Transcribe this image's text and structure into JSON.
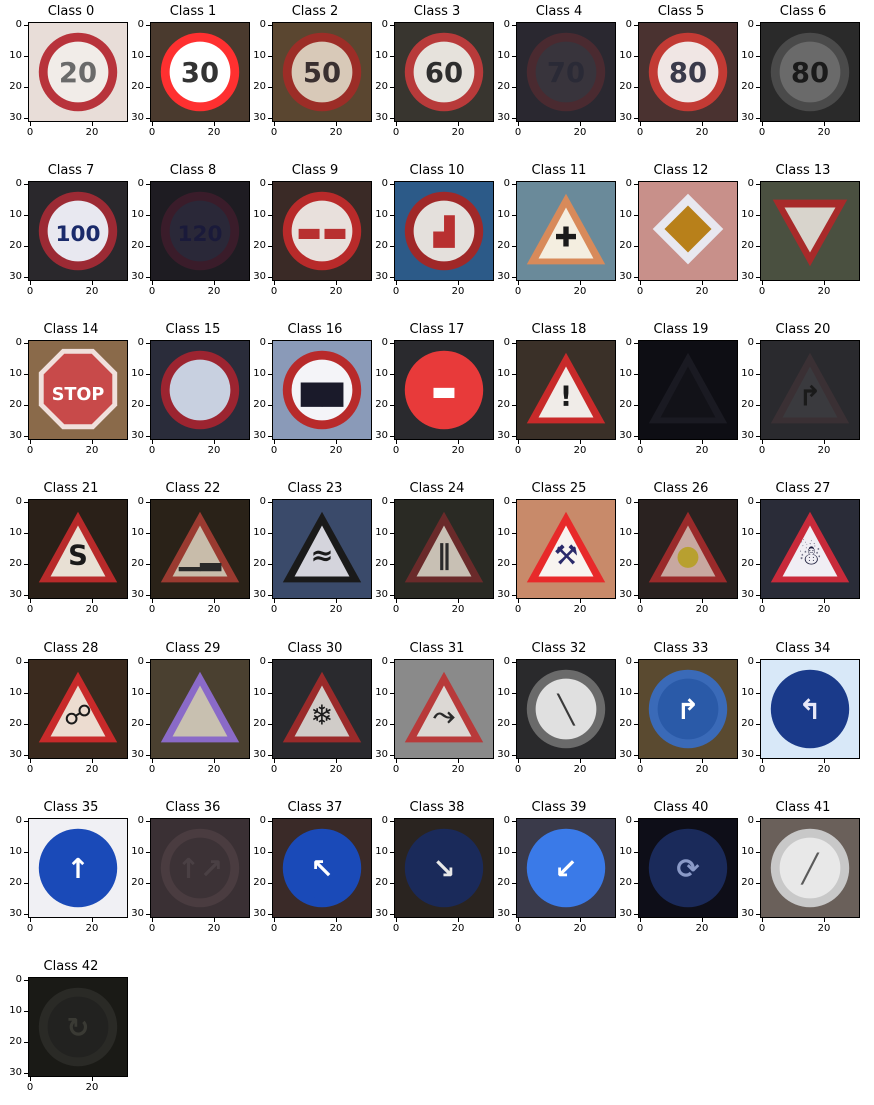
{
  "figure": {
    "axis_ticks": {
      "y": [
        "0",
        "10",
        "20",
        "30"
      ],
      "x": [
        "0",
        "20"
      ]
    },
    "panels": [
      {
        "title": "Class 0",
        "bg": "#e8ddd8",
        "shape": "circle",
        "ring": "#b8333b",
        "fill": "#f1ece8",
        "glyph": "20",
        "glyph_color": "#6a6a6a"
      },
      {
        "title": "Class 1",
        "bg": "#4a3a2e",
        "shape": "circle",
        "ring": "#ff3030",
        "fill": "#ffffff",
        "glyph": "30",
        "glyph_color": "#333333"
      },
      {
        "title": "Class 2",
        "bg": "#5a4630",
        "shape": "circle",
        "ring": "#9c2d27",
        "fill": "#d8c9b8",
        "glyph": "50",
        "glyph_color": "#3a3030"
      },
      {
        "title": "Class 3",
        "bg": "#38352f",
        "shape": "circle",
        "ring": "#b83a3a",
        "fill": "#e6e2dc",
        "glyph": "60",
        "glyph_color": "#2e2e2e"
      },
      {
        "title": "Class 4",
        "bg": "#2a2830",
        "shape": "circle",
        "ring": "#4a2a30",
        "fill": "#38343c",
        "glyph": "70",
        "glyph_color": "#2a2a36"
      },
      {
        "title": "Class 5",
        "bg": "#4a3230",
        "shape": "circle",
        "ring": "#c23a34",
        "fill": "#f0e6e4",
        "glyph": "80",
        "glyph_color": "#3a3a4a"
      },
      {
        "title": "Class 6",
        "bg": "#2a2a2a",
        "shape": "circle",
        "ring": "#4a4a4a",
        "fill": "#6a6a6a",
        "glyph": "80",
        "glyph_color": "#1a1a1a"
      },
      {
        "title": "Class 7",
        "bg": "#2a282c",
        "shape": "circle",
        "ring": "#9c2a34",
        "fill": "#e8e8f0",
        "glyph": "100",
        "glyph_color": "#1a2a6a"
      },
      {
        "title": "Class 8",
        "bg": "#1e1c22",
        "shape": "circle",
        "ring": "#3a1c2a",
        "fill": "#2a2838",
        "glyph": "120",
        "glyph_color": "#1a1a3a"
      },
      {
        "title": "Class 9",
        "bg": "#3a2a26",
        "shape": "circle",
        "ring": "#b82a2a",
        "fill": "#e8e0dc",
        "glyph": "▬▬",
        "glyph_color": "#b83030"
      },
      {
        "title": "Class 10",
        "bg": "#2c5a88",
        "shape": "circle",
        "ring": "#a02828",
        "fill": "#e4e0dc",
        "glyph": "▟",
        "glyph_color": "#b83030"
      },
      {
        "title": "Class 11",
        "bg": "#6a8a9a",
        "shape": "triangle",
        "ring": "#d88a5a",
        "fill": "#f4eee0",
        "glyph": "✚",
        "glyph_color": "#1a1a1a"
      },
      {
        "title": "Class 12",
        "bg": "#c8908a",
        "shape": "diamond",
        "ring": "#e8e8f0",
        "fill": "#b8801a",
        "glyph": "",
        "glyph_color": "#000000"
      },
      {
        "title": "Class 13",
        "bg": "#4a5040",
        "shape": "yield",
        "ring": "#a82a2a",
        "fill": "#d8d4cc",
        "glyph": "",
        "glyph_color": "#000000"
      },
      {
        "title": "Class 14",
        "bg": "#8a6a4a",
        "shape": "octagon",
        "ring": "#f0e0dc",
        "fill": "#c84a4a",
        "glyph": "STOP",
        "glyph_color": "#ffffff"
      },
      {
        "title": "Class 15",
        "bg": "#2a2c3a",
        "shape": "circle",
        "ring": "#9c2430",
        "fill": "#c8d0e0",
        "glyph": "",
        "glyph_color": "#000000"
      },
      {
        "title": "Class 16",
        "bg": "#8a9ab8",
        "shape": "circle",
        "ring": "#b82a2a",
        "fill": "#f4f4f8",
        "glyph": "▆▆",
        "glyph_color": "#1a1a2a"
      },
      {
        "title": "Class 17",
        "bg": "#2a2a2e",
        "shape": "circle",
        "ring": "#e83a3a",
        "fill": "#e83a3a",
        "glyph": "▬",
        "glyph_color": "#ffffff"
      },
      {
        "title": "Class 18",
        "bg": "#3a3028",
        "shape": "triangle",
        "ring": "#c82a2a",
        "fill": "#f0ece8",
        "glyph": "!",
        "glyph_color": "#1a1a1a"
      },
      {
        "title": "Class 19",
        "bg": "#0e0e14",
        "shape": "triangle",
        "ring": "#1a1a22",
        "fill": "#121218",
        "glyph": "",
        "glyph_color": "#000000"
      },
      {
        "title": "Class 20",
        "bg": "#2a2a2e",
        "shape": "triangle",
        "ring": "#3a3034",
        "fill": "#3a3a3e",
        "glyph": "↱",
        "glyph_color": "#1a1a1a"
      },
      {
        "title": "Class 21",
        "bg": "#2a2018",
        "shape": "triangle",
        "ring": "#b82a2a",
        "fill": "#e8e0d4",
        "glyph": "S",
        "glyph_color": "#1a1a1a"
      },
      {
        "title": "Class 22",
        "bg": "#2a2218",
        "shape": "triangle",
        "ring": "#9a3a30",
        "fill": "#c8bcaa",
        "glyph": "▁▂",
        "glyph_color": "#2a2a2a"
      },
      {
        "title": "Class 23",
        "bg": "#3a4a6a",
        "shape": "triangle",
        "ring": "#1a1a1a",
        "fill": "#d4d4dc",
        "glyph": "≈",
        "glyph_color": "#1a1a1a"
      },
      {
        "title": "Class 24",
        "bg": "#2a2a24",
        "shape": "triangle",
        "ring": "#6a2a2a",
        "fill": "#c8c0b4",
        "glyph": "∥",
        "glyph_color": "#2a2a2a"
      },
      {
        "title": "Class 25",
        "bg": "#c88a6a",
        "shape": "triangle",
        "ring": "#e82a2a",
        "fill": "#f8f4f0",
        "glyph": "⚒",
        "glyph_color": "#2a2a6a"
      },
      {
        "title": "Class 26",
        "bg": "#2a2220",
        "shape": "triangle",
        "ring": "#9a2a2a",
        "fill": "#c8a8a0",
        "glyph": "●",
        "glyph_color": "#b8a030"
      },
      {
        "title": "Class 27",
        "bg": "#2a2c38",
        "shape": "triangle",
        "ring": "#c82a3a",
        "fill": "#f0eef4",
        "glyph": "☃",
        "glyph_color": "#1a1a3a"
      },
      {
        "title": "Class 28",
        "bg": "#3a2a1e",
        "shape": "triangle",
        "ring": "#c82a2a",
        "fill": "#ecdcd0",
        "glyph": "☍",
        "glyph_color": "#1a1a1a"
      },
      {
        "title": "Class 29",
        "bg": "#4a4030",
        "shape": "triangle",
        "ring": "#8a6ac8",
        "fill": "#c8c0b0",
        "glyph": "",
        "glyph_color": "#000000"
      },
      {
        "title": "Class 30",
        "bg": "#2a2a2e",
        "shape": "triangle",
        "ring": "#9a2a2a",
        "fill": "#d0ccc8",
        "glyph": "❄",
        "glyph_color": "#1a1a1a"
      },
      {
        "title": "Class 31",
        "bg": "#8a8a8a",
        "shape": "triangle",
        "ring": "#b83a3a",
        "fill": "#dcd8d4",
        "glyph": "⤳",
        "glyph_color": "#2a2a2a"
      },
      {
        "title": "Class 32",
        "bg": "#2a2a2c",
        "shape": "circle",
        "ring": "#6a6a6a",
        "fill": "#e0e0e0",
        "glyph": "╲",
        "glyph_color": "#3a3a3a"
      },
      {
        "title": "Class 33",
        "bg": "#5a4a30",
        "shape": "circle",
        "ring": "#3a6ab8",
        "fill": "#2a5aa8",
        "glyph": "↱",
        "glyph_color": "#ffffff"
      },
      {
        "title": "Class 34",
        "bg": "#d8e8f8",
        "shape": "circle",
        "ring": "#1a3a8a",
        "fill": "#1a3a8a",
        "glyph": "↰",
        "glyph_color": "#e8e8f8"
      },
      {
        "title": "Class 35",
        "bg": "#f0f0f4",
        "shape": "circle",
        "ring": "#1a4ab8",
        "fill": "#1a4ab8",
        "glyph": "↑",
        "glyph_color": "#ffffff"
      },
      {
        "title": "Class 36",
        "bg": "#3a3034",
        "shape": "circle",
        "ring": "#4a3c40",
        "fill": "#3c3236",
        "glyph": "↑↗",
        "glyph_color": "#4a4044"
      },
      {
        "title": "Class 37",
        "bg": "#3a2a28",
        "shape": "circle",
        "ring": "#1a4ab8",
        "fill": "#1a4ab8",
        "glyph": "↖",
        "glyph_color": "#ffffff"
      },
      {
        "title": "Class 38",
        "bg": "#2a2420",
        "shape": "circle",
        "ring": "#1a2a5a",
        "fill": "#1a2a5a",
        "glyph": "↘",
        "glyph_color": "#e8e8e8"
      },
      {
        "title": "Class 39",
        "bg": "#3a3a4a",
        "shape": "circle",
        "ring": "#3a7ae8",
        "fill": "#3a7ae8",
        "glyph": "↙",
        "glyph_color": "#ffffff"
      },
      {
        "title": "Class 40",
        "bg": "#0e0e18",
        "shape": "circle",
        "ring": "#1a2a5a",
        "fill": "#1a2a5a",
        "glyph": "⟳",
        "glyph_color": "#8a9ac8"
      },
      {
        "title": "Class 41",
        "bg": "#6a605a",
        "shape": "circle",
        "ring": "#c8c8c8",
        "fill": "#e8e8e8",
        "glyph": "╱",
        "glyph_color": "#5a5a5a"
      },
      {
        "title": "Class 42",
        "bg": "#1a1a16",
        "shape": "circle",
        "ring": "#2a2a26",
        "fill": "#222220",
        "glyph": "↻",
        "glyph_color": "#3a3a34"
      }
    ]
  }
}
